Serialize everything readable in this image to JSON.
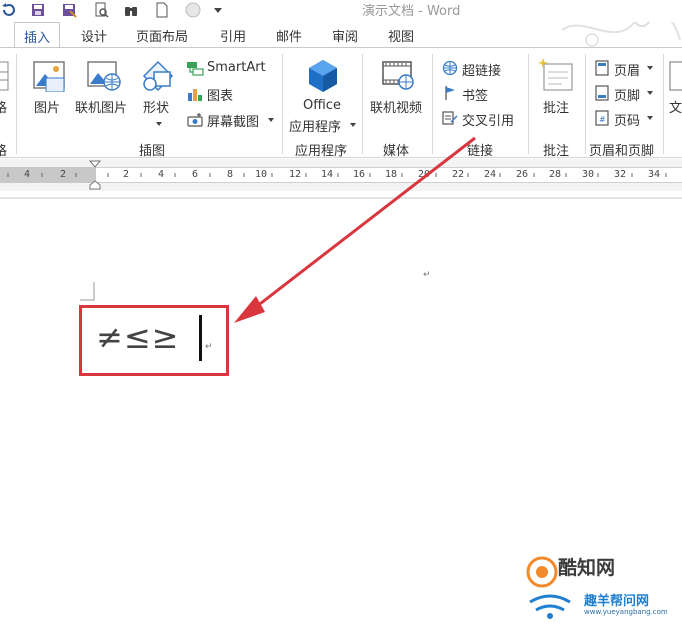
{
  "window": {
    "title": "演示文档 - Word"
  },
  "tabs": [
    {
      "label": "插入",
      "active": true
    },
    {
      "label": "设计"
    },
    {
      "label": "页面布局"
    },
    {
      "label": "引用"
    },
    {
      "label": "邮件"
    },
    {
      "label": "审阅"
    },
    {
      "label": "视图"
    }
  ],
  "ribbon": {
    "left_clipped_top": "格",
    "left_clipped_bottom": "格",
    "illustrations": {
      "picture": "图片",
      "online_picture": "联机图片",
      "shapes": "形状",
      "smartart": "SmartArt",
      "chart": "图表",
      "screenshot": "屏幕截图",
      "group": "插图"
    },
    "apps": {
      "office_line1": "Office",
      "office_line2": "应用程序",
      "group": "应用程序"
    },
    "media": {
      "online_video": "联机视频",
      "group": "媒体"
    },
    "links": {
      "hyperlink": "超链接",
      "bookmark": "书签",
      "cross_reference": "交叉引用",
      "group": "链接"
    },
    "comments": {
      "comment": "批注",
      "group": "批注"
    },
    "header_footer": {
      "header": "页眉",
      "footer": "页脚",
      "page_number": "页码",
      "group": "页眉和页脚"
    },
    "text_clipped": "文"
  },
  "ruler": {
    "labels": [
      "4",
      "2",
      "2",
      "4",
      "6",
      "8",
      "10",
      "12",
      "14",
      "16",
      "18",
      "20",
      "22",
      "24",
      "26",
      "28",
      "30",
      "32",
      "34"
    ]
  },
  "document": {
    "symbols": "≠≤≥"
  },
  "watermark": {
    "brand": "酷知网",
    "brand2": "趣羊帮问网",
    "url": "www.yueyangbang.com"
  },
  "colors": {
    "accent": "#2b579a",
    "highlight": "#d9363e",
    "arrow": "#d9363e"
  }
}
